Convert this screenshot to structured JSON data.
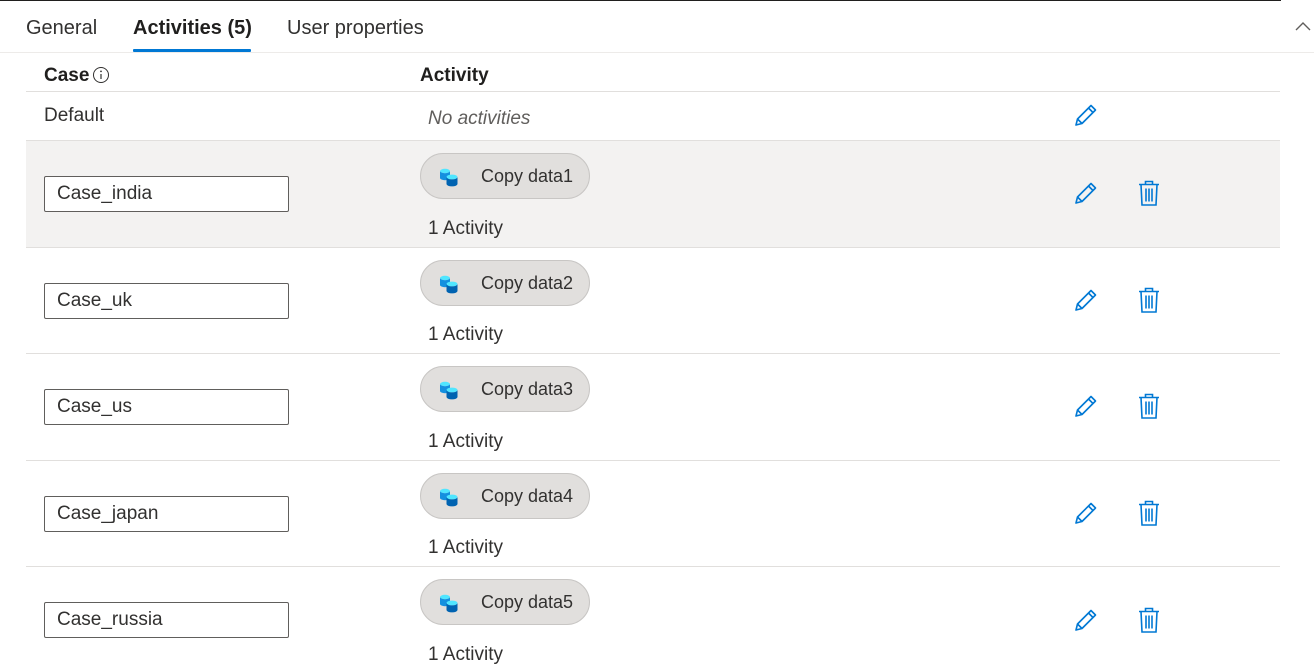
{
  "tabs": [
    {
      "label": "General"
    },
    {
      "label": "Activities (5)"
    },
    {
      "label": "User properties"
    }
  ],
  "table": {
    "columns": {
      "case": "Case",
      "activity": "Activity"
    },
    "default_row": {
      "label": "Default",
      "activities_text": "No activities"
    },
    "rows": [
      {
        "case_value": "Case_india",
        "activity_name": "Copy data1",
        "count": "1 Activity"
      },
      {
        "case_value": "Case_uk",
        "activity_name": "Copy data2",
        "count": "1 Activity"
      },
      {
        "case_value": "Case_us",
        "activity_name": "Copy data3",
        "count": "1 Activity"
      },
      {
        "case_value": "Case_japan",
        "activity_name": "Copy data4",
        "count": "1 Activity"
      },
      {
        "case_value": "Case_russia",
        "activity_name": "Copy data5",
        "count": "1 Activity"
      }
    ]
  },
  "icons": {
    "collapse": "chevron-up-icon",
    "info": "info-icon",
    "activity": "copy-data-icon",
    "edit": "pencil-icon",
    "delete": "trash-icon"
  },
  "colors": {
    "accent": "#0078d4",
    "selected_row": "#f3f2f1",
    "chip_bg": "#e1dfdd"
  }
}
